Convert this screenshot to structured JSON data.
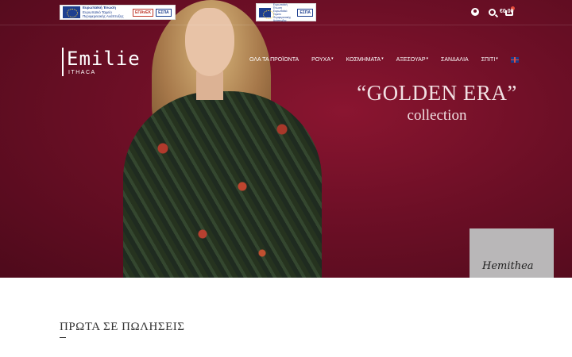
{
  "topbar": {
    "banner_left": {
      "title": "Ευρωπαϊκή Ένωση",
      "line1": "Ευρωπαϊκό Ταμείο",
      "line2": "Περιφερειακής Ανάπτυξης",
      "logo1": "ΕΠΑνΕΚ",
      "logo2": "ΕΣΠΑ"
    },
    "banner_right": {
      "title": "Ευρωπαϊκή Ένωση",
      "line1": "Ευρωπαϊκό Ταμείο Περιφερειακής Ανάπτυξης",
      "logo": "ΕΣΠΑ"
    },
    "cart_badge": "0",
    "cart_total": "€0.00"
  },
  "logo": {
    "name": "Emilie",
    "subtitle": "ITHACA"
  },
  "nav": {
    "items": [
      {
        "label": "ΟΛΑ ΤΑ ΠΡΟΪΟΝΤΑ",
        "has_dropdown": false
      },
      {
        "label": "ΡΟΥΧΑ",
        "has_dropdown": true
      },
      {
        "label": "ΚΟΣΜΗΜΑΤΑ",
        "has_dropdown": true
      },
      {
        "label": "ΑΞΕΣΟΥΑΡ",
        "has_dropdown": true
      },
      {
        "label": "ΣΑΝΔΑΛΙΑ",
        "has_dropdown": false
      },
      {
        "label": "ΣΠΙΤΙ",
        "has_dropdown": true
      }
    ],
    "language_icon": "uk-flag-icon"
  },
  "hero": {
    "tagline_line1": "“GOLDEN ERA”",
    "tagline_line2": "collection",
    "accent_color": "#6d0f26",
    "promo_signature": "Hemithea"
  },
  "section": {
    "title": "ΠΡΩΤΑ ΣΕ ΠΩΛΗΣΕΙΣ"
  }
}
